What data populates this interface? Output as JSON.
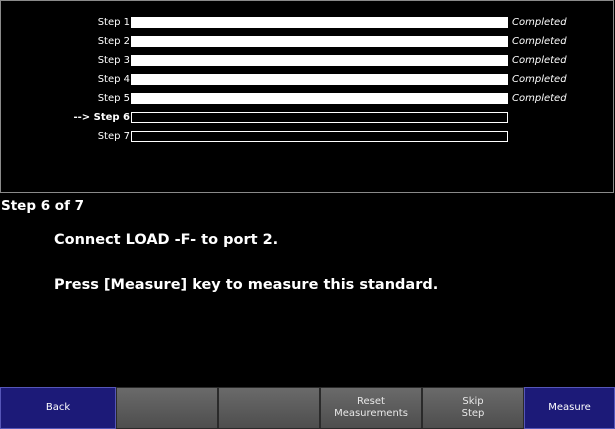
{
  "steps": [
    {
      "label": "Step 1",
      "status": "Completed",
      "progress": 1,
      "active": false
    },
    {
      "label": "Step 2",
      "status": "Completed",
      "progress": 1,
      "active": false
    },
    {
      "label": "Step 3",
      "status": "Completed",
      "progress": 1,
      "active": false
    },
    {
      "label": "Step 4",
      "status": "Completed",
      "progress": 1,
      "active": false
    },
    {
      "label": "Step 5",
      "status": "Completed",
      "progress": 1,
      "active": false
    },
    {
      "label": "--> Step 6",
      "status": "",
      "progress": 0,
      "active": true
    },
    {
      "label": "Step 7",
      "status": "",
      "progress": 0,
      "active": false
    }
  ],
  "current": {
    "title": "Step 6 of 7",
    "instruction_1": "Connect LOAD -F- to port 2.",
    "instruction_2": "Press [Measure] key to measure this standard."
  },
  "softkeys": {
    "back": "Back",
    "blank_1": "",
    "blank_2": "",
    "reset_line1": "Reset",
    "reset_line2": "Measurements",
    "skip_line1": "Skip",
    "skip_line2": "Step",
    "measure": "Measure"
  },
  "colors": {
    "background": "#000000",
    "softkey_blue": "#1c1a78",
    "softkey_gray": "#5c5c5c"
  }
}
